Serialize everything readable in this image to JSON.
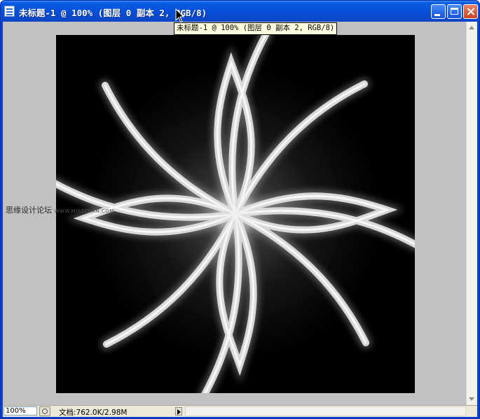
{
  "window": {
    "title": "未标题-1 @ 100% (图层 0 副本 2, RGB/8)",
    "tooltip": "未标题-1 @ 100% (图层 0 副本 2, RGB/8)"
  },
  "statusbar": {
    "zoom": "100%",
    "doc_info": "文档:762.0K/2.98M"
  },
  "watermark": {
    "cn": "思缘设计论坛",
    "url": "WWW.MISSYUAN.COM"
  },
  "icons": {
    "app": "document-icon",
    "minimize": "minimize-icon",
    "maximize": "maximize-icon",
    "close": "close-icon",
    "cursor": "arrow-cursor-icon"
  }
}
